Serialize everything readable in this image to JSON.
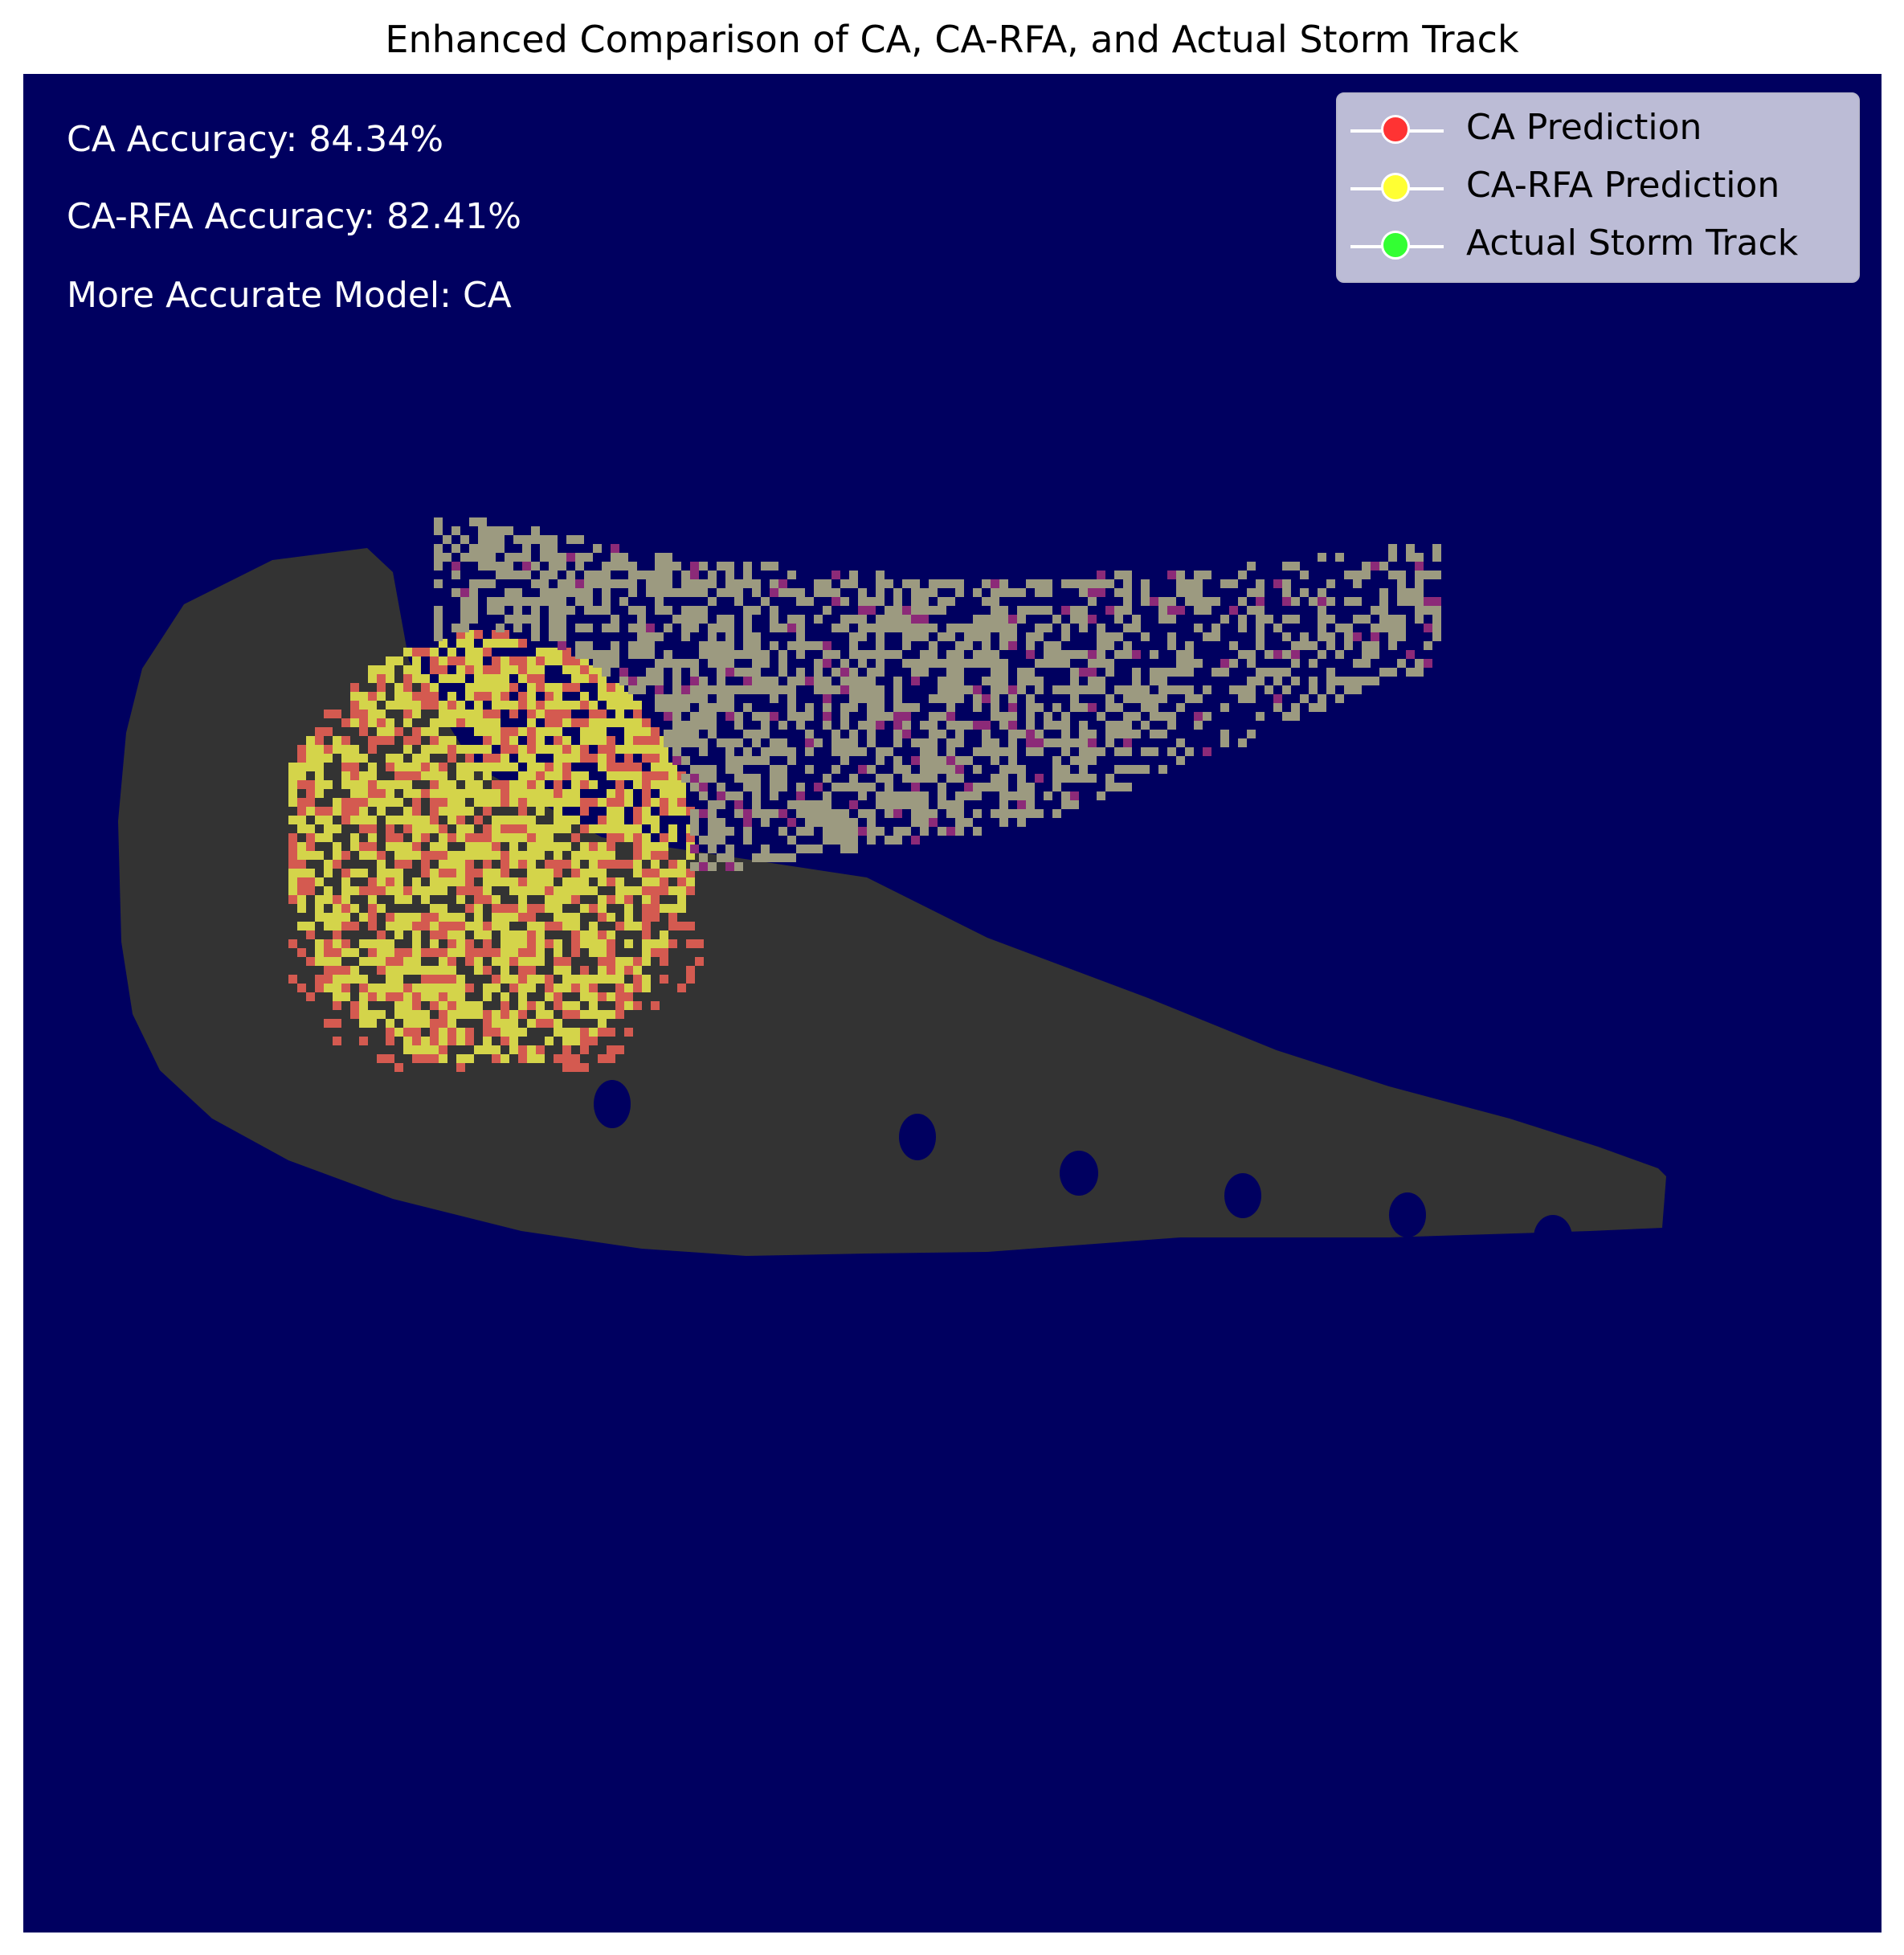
{
  "chart_data": {
    "type": "heatmap",
    "title": "Enhanced Comparison of CA, CA-RFA, and Actual Storm Track",
    "xlabel": "",
    "ylabel": "",
    "axes_visible": false,
    "grid": false,
    "legend_placement": "top-right",
    "annotations": {
      "ca_accuracy": "CA Accuracy: 84.34%",
      "carfa_accuracy": "CA-RFA Accuracy: 82.41%",
      "more_accurate": "More Accurate Model: CA"
    },
    "metrics": {
      "ca_accuracy_percent": 84.34,
      "carfa_accuracy_percent": 82.41,
      "more_accurate_model": "CA"
    },
    "legend": [
      {
        "label": "CA Prediction",
        "color": "#ff3333"
      },
      {
        "label": "CA-RFA Prediction",
        "color": "#ffff33"
      },
      {
        "label": "Actual Storm Track",
        "color": "#33ff33"
      }
    ],
    "colors": {
      "background": "#000060",
      "actual_track_region": "#333333",
      "ca_cells": "#d45a50",
      "carfa_cells": "#d4d44a",
      "overlap_cells": "#9c9a80",
      "magenta_cells": "#8c2a78"
    }
  }
}
